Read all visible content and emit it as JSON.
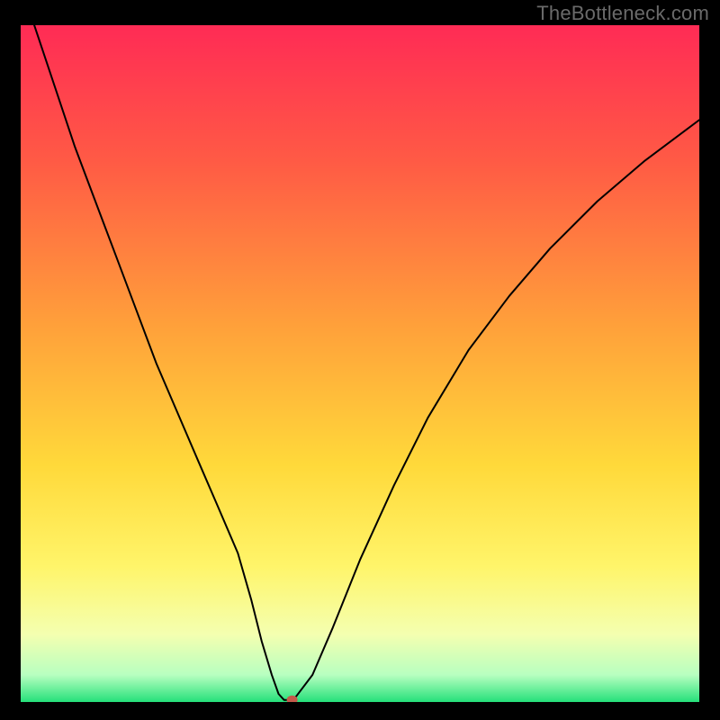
{
  "attribution": "TheBottleneck.com",
  "colors": {
    "page_bg": "#000000",
    "curve": "#000000",
    "marker": "#c45a4a",
    "gradient_stops": [
      {
        "offset": 0,
        "color": "#ff2b55"
      },
      {
        "offset": 20,
        "color": "#ff5a45"
      },
      {
        "offset": 45,
        "color": "#ffa23a"
      },
      {
        "offset": 65,
        "color": "#ffd93a"
      },
      {
        "offset": 80,
        "color": "#fff56a"
      },
      {
        "offset": 90,
        "color": "#f4ffb0"
      },
      {
        "offset": 96,
        "color": "#b8ffc0"
      },
      {
        "offset": 100,
        "color": "#25e07a"
      }
    ]
  },
  "chart_data": {
    "type": "line",
    "title": "",
    "xlabel": "",
    "ylabel": "",
    "xlim": [
      0,
      100
    ],
    "ylim": [
      0,
      100
    ],
    "grid": false,
    "legend": false,
    "series": [
      {
        "name": "bottleneck-curve",
        "x": [
          2,
          5,
          8,
          11,
          14,
          17,
          20,
          23,
          26,
          29,
          32,
          34,
          35.5,
          37,
          38,
          38.8,
          39.5,
          40.2,
          43,
          46,
          50,
          55,
          60,
          66,
          72,
          78,
          85,
          92,
          100
        ],
        "y": [
          100,
          91,
          82,
          74,
          66,
          58,
          50,
          43,
          36,
          29,
          22,
          15,
          9,
          4,
          1.2,
          0.3,
          0.3,
          0.3,
          4,
          11,
          21,
          32,
          42,
          52,
          60,
          67,
          74,
          80,
          86
        ]
      }
    ],
    "flat_bottom": {
      "x_start": 38,
      "x_end": 40.2,
      "y": 0.3
    },
    "marker": {
      "x": 40,
      "y": 0.3
    },
    "note": "V-shaped bottleneck curve on a vertical red→green gradient background; minimum (optimal point) at roughly x≈40 where the curve touches the green zone at the bottom."
  }
}
